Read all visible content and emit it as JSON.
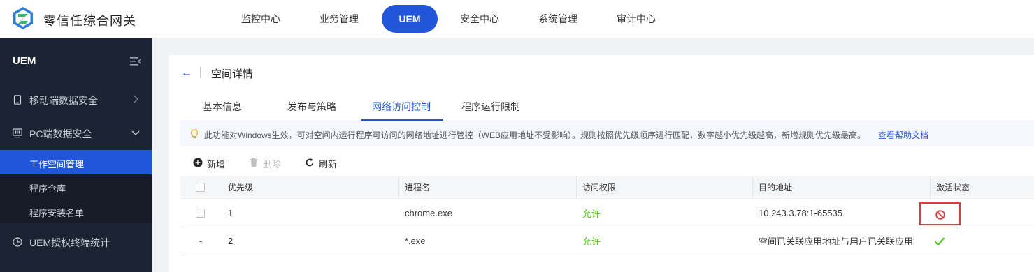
{
  "app": {
    "title": "零信任综合网关",
    "accent": "#2256d8"
  },
  "nav": {
    "items": [
      {
        "label": "监控中心"
      },
      {
        "label": "业务管理"
      },
      {
        "label": "UEM",
        "active": true
      },
      {
        "label": "安全中心"
      },
      {
        "label": "系统管理"
      },
      {
        "label": "审计中心"
      }
    ]
  },
  "sidebar": {
    "header": "UEM",
    "groups": [
      {
        "label": "移动端数据安全",
        "icon": "mobile-icon",
        "expanded": false
      },
      {
        "label": "PC端数据安全",
        "icon": "monitor-icon",
        "expanded": true
      },
      {
        "label": "UEM授权终端统计",
        "icon": "clock-icon",
        "expanded": false
      }
    ],
    "sub_items": [
      {
        "label": "工作空间管理",
        "active": true
      },
      {
        "label": "程序仓库"
      },
      {
        "label": "程序安装名单"
      }
    ]
  },
  "page": {
    "title": "空间详情",
    "tabs": [
      {
        "label": "基本信息"
      },
      {
        "label": "发布与策略"
      },
      {
        "label": "网络访问控制",
        "active": true
      },
      {
        "label": "程序运行限制"
      }
    ],
    "notice": {
      "text": "此功能对Windows生效，可对空间内运行程序可访问的网络地址进行管控（WEB应用地址不受影响）。规则按照优先级顺序进行匹配，数字越小优先级越高，新增规则优先级最高。",
      "help_link": "查看帮助文档"
    },
    "toolbar": {
      "add": "新增",
      "delete": "删除",
      "refresh": "刷新"
    }
  },
  "table": {
    "columns": [
      "优先级",
      "进程名",
      "访问权限",
      "目的地址",
      "激活状态"
    ],
    "rows": [
      {
        "select": "",
        "priority": "1",
        "process": "chrome.exe",
        "permission": "允许",
        "destination": "10.243.3.78:1-65535",
        "status": "disabled"
      },
      {
        "select": "-",
        "priority": "2",
        "process": "*.exe",
        "permission": "允许",
        "destination": "空间已关联应用地址与用户已关联应用地...",
        "status": "active"
      }
    ]
  }
}
